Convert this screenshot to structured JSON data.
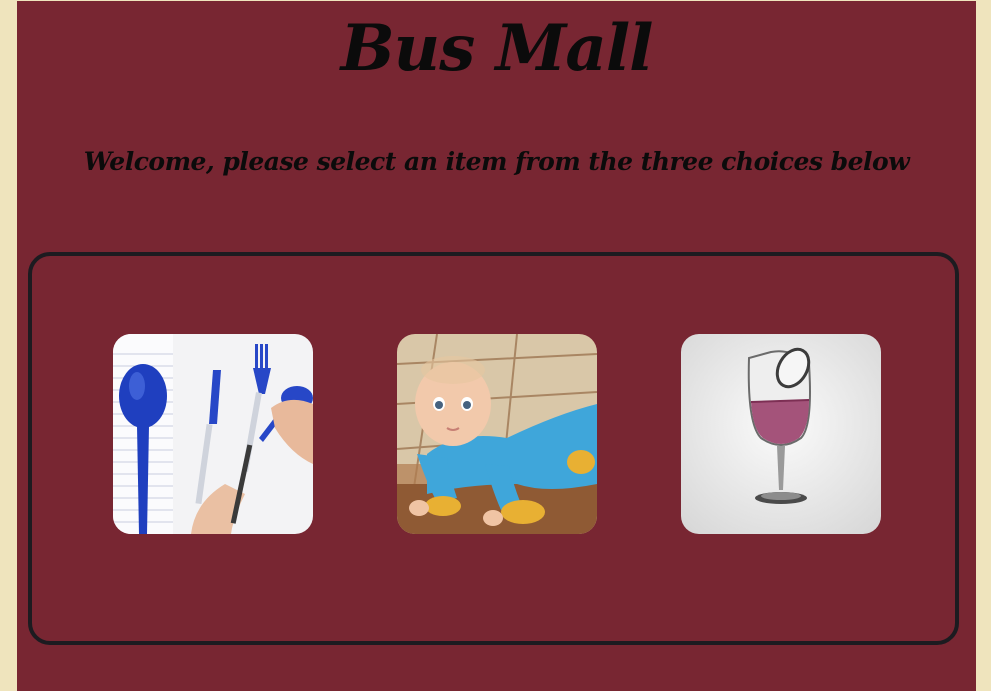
{
  "header": {
    "title": "Bus Mall",
    "subtitle": "Welcome, please select an item from the three choices below"
  },
  "choices": [
    {
      "image": "pen-utensils-photo"
    },
    {
      "image": "baby-sweep-onesie-photo"
    },
    {
      "image": "wine-glass-photo"
    }
  ],
  "colors": {
    "page_background": "#782632",
    "side_background": "#efe4bd",
    "text": "#0b0b0b",
    "box_border": "#1c1b20"
  }
}
